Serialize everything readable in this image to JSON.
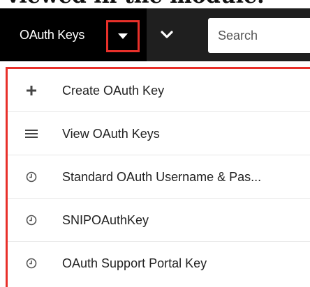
{
  "caption": "viewed in the module.",
  "navbar": {
    "module_tab_label": "OAuth Keys",
    "search_placeholder": "Search"
  },
  "menu": {
    "items": [
      {
        "label": "Create OAuth Key",
        "icon": "plus-icon"
      },
      {
        "label": "View OAuth Keys",
        "icon": "list-icon"
      },
      {
        "label": "Standard OAuth Username & Pas...",
        "icon": "clock-icon"
      },
      {
        "label": "SNIPOAuthKey",
        "icon": "clock-icon"
      },
      {
        "label": "OAuth Support Portal Key",
        "icon": "clock-icon"
      }
    ]
  },
  "colors": {
    "navbar_bg": "#1f1f1f",
    "module_tab_bg": "#000000",
    "highlight_border": "#e8302a"
  }
}
